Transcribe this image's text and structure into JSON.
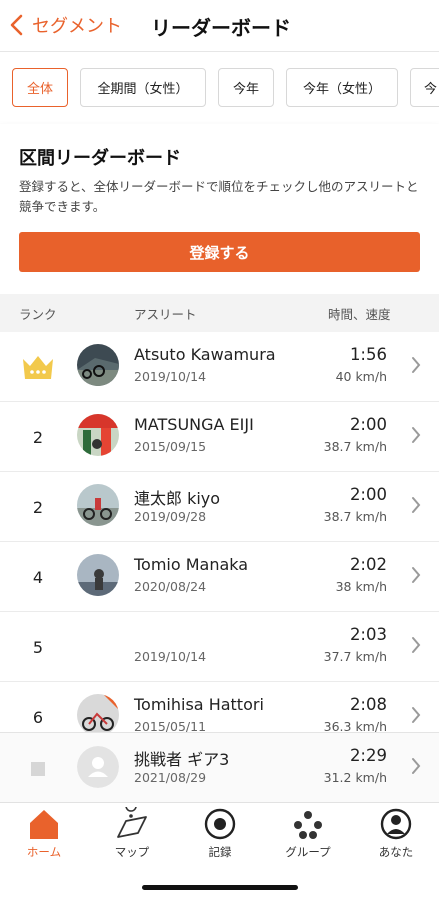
{
  "header": {
    "back_label": "セグメント",
    "title": "リーダーボード"
  },
  "filters": [
    {
      "label": "全体",
      "active": true
    },
    {
      "label": "全期間（女性）",
      "active": false
    },
    {
      "label": "今年",
      "active": false
    },
    {
      "label": "今年（女性）",
      "active": false
    },
    {
      "label": "今",
      "active": false
    }
  ],
  "card": {
    "title": "区間リーダーボード",
    "description": "登録すると、全体リーダーボードで順位をチェックし他のアスリートと競争できます。",
    "button_label": "登録する"
  },
  "columns": {
    "rank": "ランク",
    "athlete": "アスリート",
    "time_speed": "時間、速度"
  },
  "rows": [
    {
      "rank": "",
      "crown": true,
      "name": "Atsuto Kawamura",
      "date": "2019/10/14",
      "time": "1:56",
      "speed": "40 km/h"
    },
    {
      "rank": "2",
      "crown": false,
      "name": "MATSUNGA EIJI",
      "date": "2015/09/15",
      "time": "2:00",
      "speed": "38.7 km/h"
    },
    {
      "rank": "2",
      "crown": false,
      "name": "連太郎 kiyo",
      "date": "2019/09/28",
      "time": "2:00",
      "speed": "38.7 km/h"
    },
    {
      "rank": "4",
      "crown": false,
      "name": "Tomio Manaka",
      "date": "2020/08/24",
      "time": "2:02",
      "speed": "38 km/h"
    },
    {
      "rank": "5",
      "crown": false,
      "name": "",
      "date": "2019/10/14",
      "time": "2:03",
      "speed": "37.7 km/h"
    },
    {
      "rank": "6",
      "crown": false,
      "name": "Tomihisa Hattori",
      "date": "2015/05/11",
      "time": "2:08",
      "speed": "36.3 km/h"
    }
  ],
  "my_entry": {
    "name": "挑戦者 ギア3",
    "date": "2021/08/29",
    "time": "2:29",
    "speed": "31.2 km/h"
  },
  "tabs": [
    {
      "label": "ホーム",
      "icon": "home-icon",
      "active": true
    },
    {
      "label": "マップ",
      "icon": "map-icon",
      "active": false
    },
    {
      "label": "記録",
      "icon": "record-icon",
      "active": false
    },
    {
      "label": "グループ",
      "icon": "groups-icon",
      "active": false
    },
    {
      "label": "あなた",
      "icon": "profile-icon",
      "active": false
    }
  ],
  "colors": {
    "accent": "#e9622c",
    "crown": "#f2c94c"
  }
}
